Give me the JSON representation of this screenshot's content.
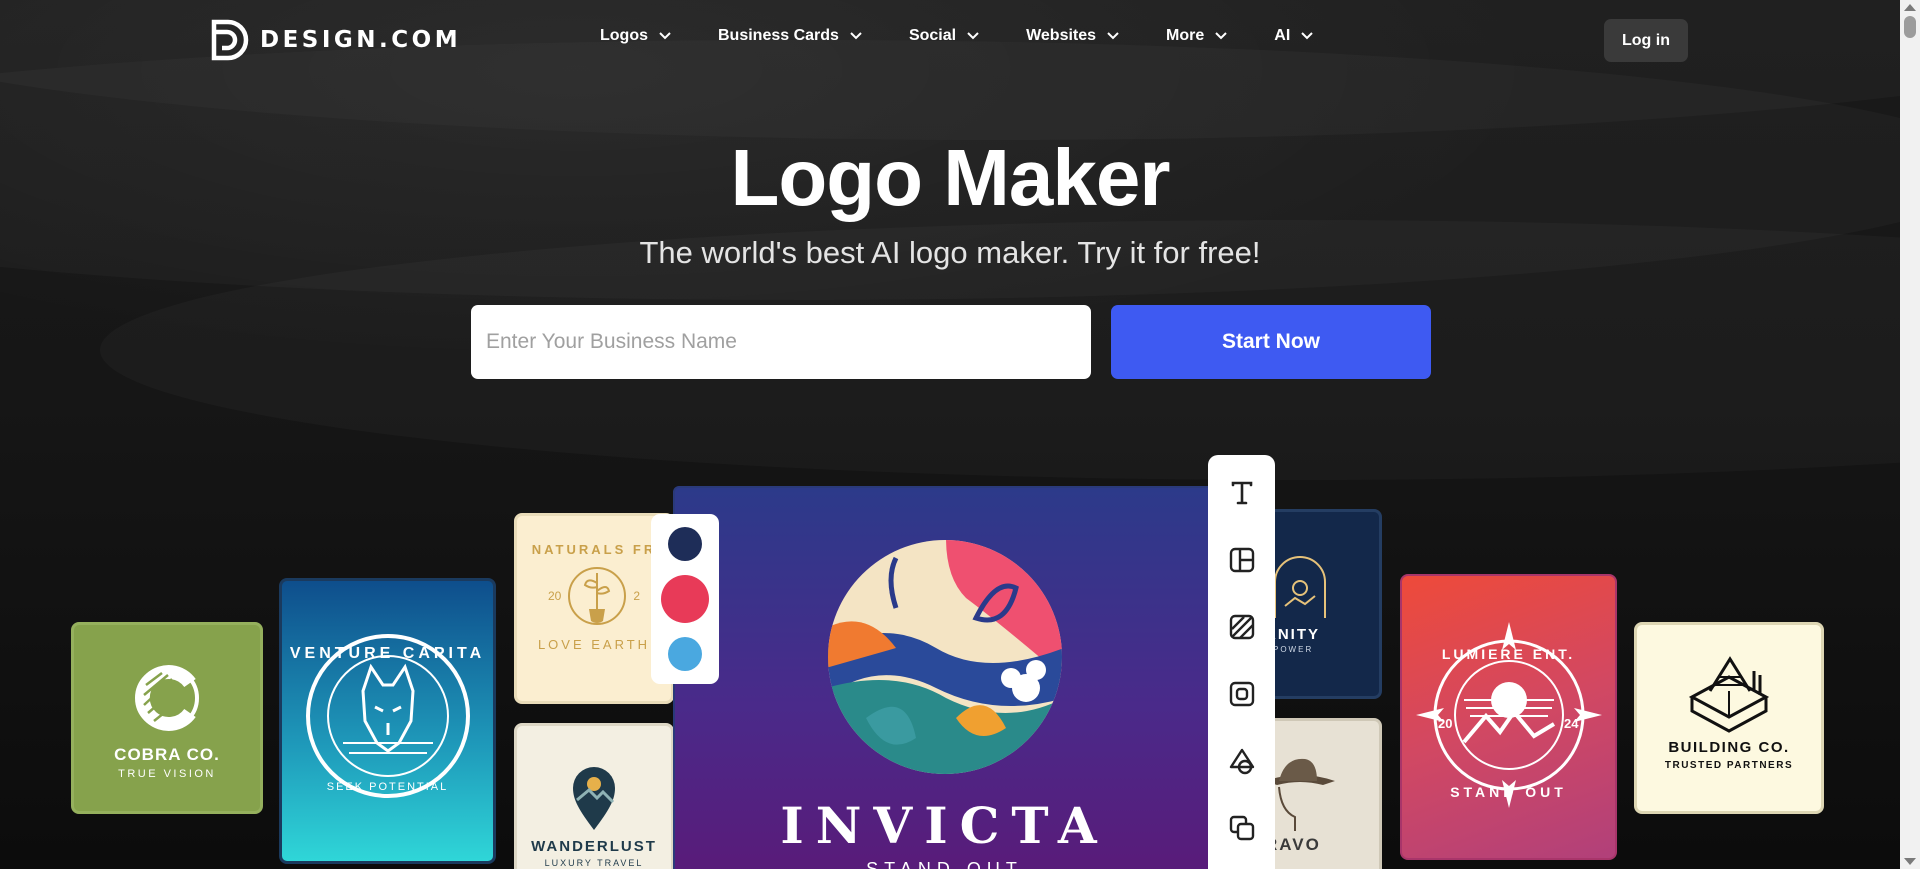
{
  "header": {
    "brand": "DESIGN.COM",
    "nav": [
      {
        "label": "Logos"
      },
      {
        "label": "Business Cards"
      },
      {
        "label": "Social"
      },
      {
        "label": "Websites"
      },
      {
        "label": "More"
      },
      {
        "label": "AI"
      }
    ],
    "login_label": "Log in"
  },
  "hero": {
    "title": "Logo Maker",
    "subtitle": "The world's best AI logo maker. Try it for free!",
    "input_placeholder": "Enter Your Business Name",
    "cta_label": "Start Now"
  },
  "showcase": {
    "cobra": {
      "name": "COBRA CO.",
      "tagline": "TRUE VISION"
    },
    "venture": {
      "name": "VENTURE CAPITA",
      "tagline": "SEEK POTENTIAL"
    },
    "naturals": {
      "name": "NATURALS FR",
      "tagline": "LOVE EARTH",
      "year_left": "20",
      "year_right": "2"
    },
    "wanderlust": {
      "name": "WANDERLUST",
      "tagline": "LUXURY TRAVEL"
    },
    "invicta": {
      "name": "INVICTA",
      "tagline": "STAND OUT"
    },
    "eternity": {
      "name": "RNITY",
      "tagline": "POWER"
    },
    "bravo": {
      "name": "RAVO"
    },
    "lumiere": {
      "name": "LUMIERE ENT.",
      "tagline": "STAND OUT",
      "year_left": "20",
      "year_right": "24"
    },
    "building": {
      "name": "BUILDING CO.",
      "tagline": "TRUSTED PARTNERS"
    }
  },
  "palette": {
    "colors": [
      "#1e2d58",
      "#e83a58",
      "#4aa8e0"
    ]
  },
  "toolbar": {
    "tools": [
      "text-tool-icon",
      "layout-tool-icon",
      "pattern-tool-icon",
      "frame-tool-icon",
      "shape-tool-icon",
      "layers-tool-icon"
    ]
  },
  "colors": {
    "accent": "#3e5af2",
    "background": "#141414"
  }
}
